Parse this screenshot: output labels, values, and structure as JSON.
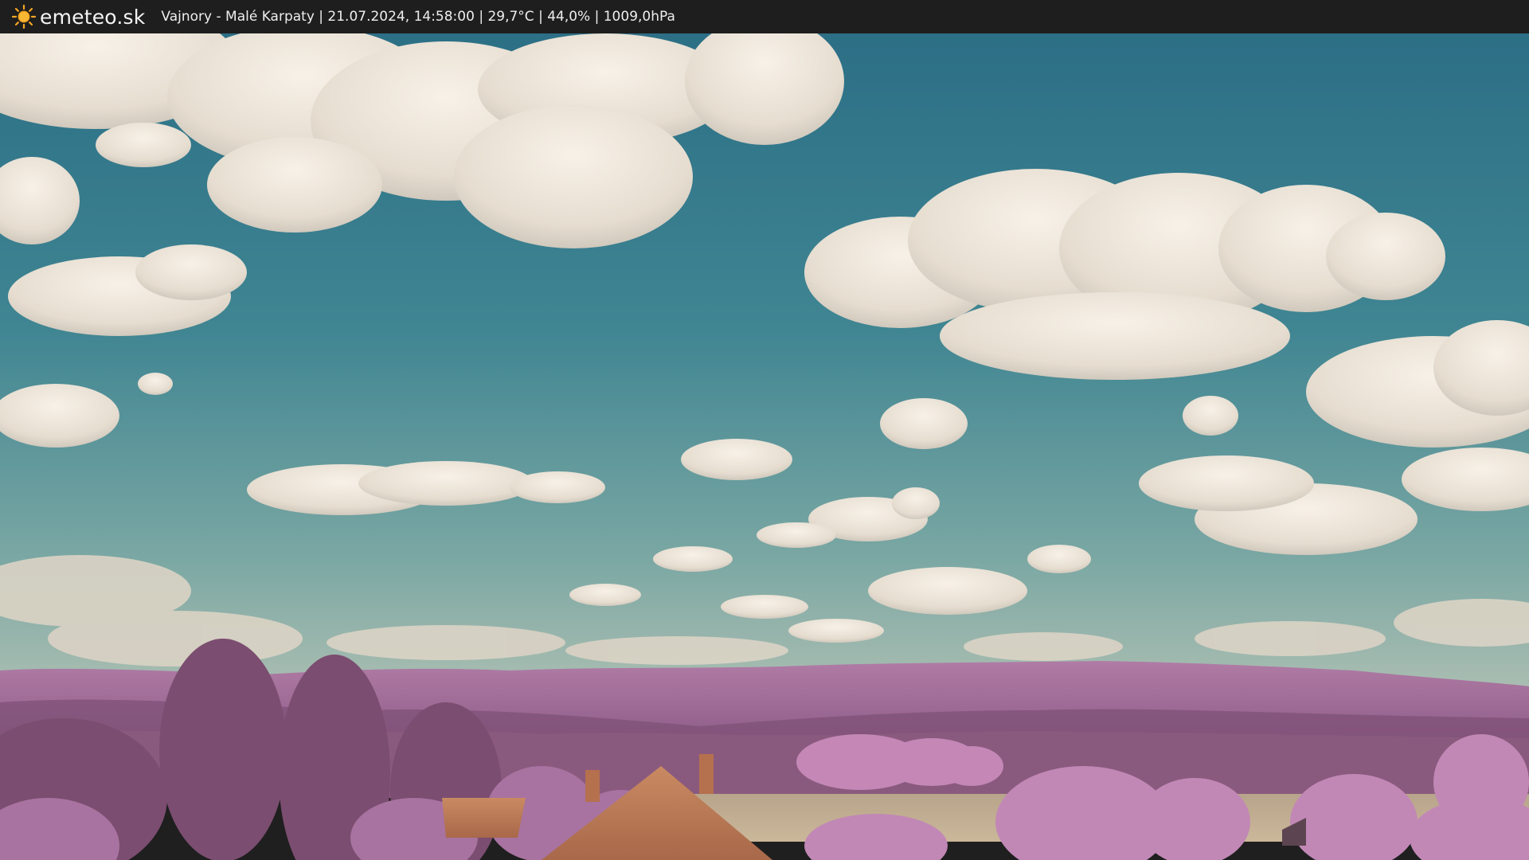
{
  "header": {
    "brand": "emeteo.sk",
    "caption": "Vajnory - Malé Karpaty | 21.07.2024, 14:58:00 | 29,7°C | 44,0% | 1009,0hPa",
    "logo_icon": "sun-icon"
  },
  "colors": {
    "bar": "#1e1e1e",
    "sun": "#f5a623",
    "sky_top": "#2f7286",
    "sky_bottom": "#8fb0a8",
    "cloud": "#efe7dc",
    "hills": "#a06a98",
    "foliage": "#b67aa8",
    "roof": "#c07852"
  }
}
